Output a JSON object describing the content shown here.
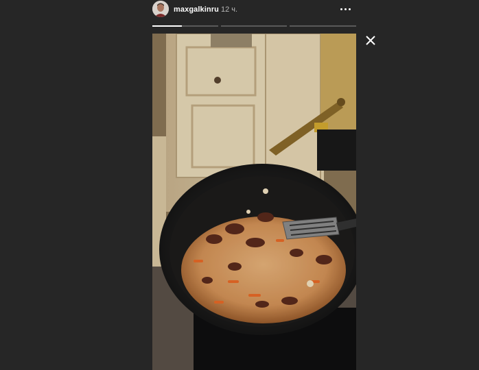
{
  "story": {
    "username": "maxgalkinru",
    "timestamp": "12 ч.",
    "progress_segments": [
      {
        "fill": 0.45
      },
      {
        "fill": 0
      },
      {
        "fill": 0
      }
    ]
  },
  "icons": {
    "more": "more-horizontal-icon",
    "close": "close-icon",
    "avatar": "profile-avatar"
  },
  "colors": {
    "background": "#262626",
    "text": "#ffffff",
    "muted": "#b8b8b8",
    "progress_track": "#5a5a5a",
    "progress_fill": "#ffffff"
  }
}
